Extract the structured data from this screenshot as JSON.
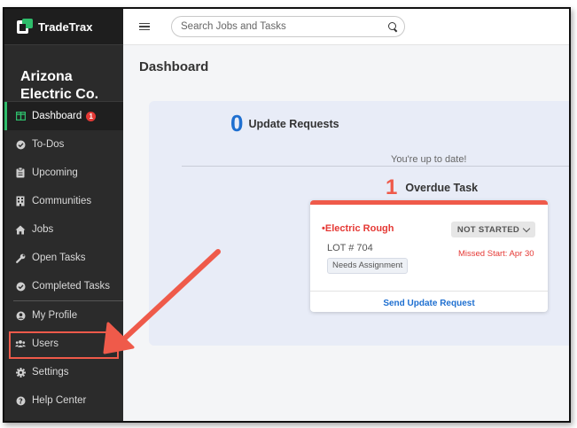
{
  "app": {
    "name": "TradeTrax"
  },
  "sidebar": {
    "company_line1": "Arizona",
    "company_line2": "Electric Co.",
    "items": [
      {
        "label": "Dashboard",
        "icon": "dashboard-icon",
        "badge": "1",
        "active": true
      },
      {
        "label": "To-Dos",
        "icon": "check-circle-icon"
      },
      {
        "label": "Upcoming",
        "icon": "clipboard-icon"
      },
      {
        "label": "Communities",
        "icon": "building-icon"
      },
      {
        "label": "Jobs",
        "icon": "home-icon"
      },
      {
        "label": "Open Tasks",
        "icon": "wrench-icon"
      },
      {
        "label": "Completed Tasks",
        "icon": "check-circle-icon"
      },
      {
        "label": "My Profile",
        "icon": "user-circle-icon"
      },
      {
        "label": "Users",
        "icon": "users-icon"
      },
      {
        "label": "Settings",
        "icon": "gear-icon"
      },
      {
        "label": "Help Center",
        "icon": "question-circle-icon"
      }
    ]
  },
  "topbar": {
    "search_placeholder": "Search Jobs and Tasks"
  },
  "main": {
    "title": "Dashboard",
    "update_requests": {
      "count": "0",
      "label": "Update Requests",
      "status": "You're up to date!"
    },
    "overdue": {
      "count": "1",
      "label": "Overdue Task"
    },
    "task_card": {
      "name": "•Electric Rough",
      "status": "NOT STARTED",
      "lot": "LOT # 704",
      "missed": "Missed Start: Apr 30",
      "tag": "Needs Assignment",
      "action": "Send Update Request"
    }
  },
  "colors": {
    "accent": "#2ebd6b",
    "alert": "#ef5a4a",
    "link": "#1e6fd0",
    "sidebar": "#2b2b2b"
  }
}
